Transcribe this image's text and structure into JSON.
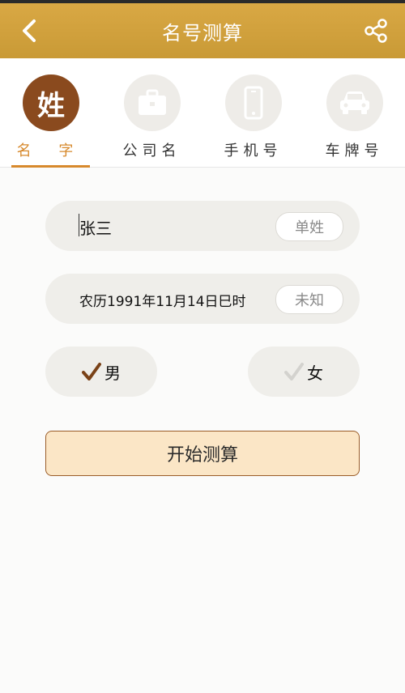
{
  "header": {
    "title": "名号测算",
    "back_icon": "chevron-left-icon",
    "share_icon": "share-icon"
  },
  "tabs": [
    {
      "label": "名 字",
      "glyph": "姓",
      "icon": "surname-badge-icon",
      "active": true
    },
    {
      "label": "公司名",
      "icon": "briefcase-icon",
      "active": false
    },
    {
      "label": "手机号",
      "icon": "phone-icon",
      "active": false
    },
    {
      "label": "车牌号",
      "icon": "car-icon",
      "active": false
    }
  ],
  "form": {
    "name_value": "张三",
    "surname_type": "单姓",
    "birth_value": "农历1991年11月14日巳时",
    "birth_unknown": "未知",
    "gender_male": "男",
    "gender_female": "女",
    "selected_gender": "男"
  },
  "actions": {
    "start_label": "开始测算"
  },
  "colors": {
    "header": "#d2a23f",
    "accent": "#d7892c",
    "active_circle": "#8a4a1e",
    "button_bg": "#fbe6c6",
    "button_border": "#9a5c28",
    "field_bg": "#efeeea"
  }
}
